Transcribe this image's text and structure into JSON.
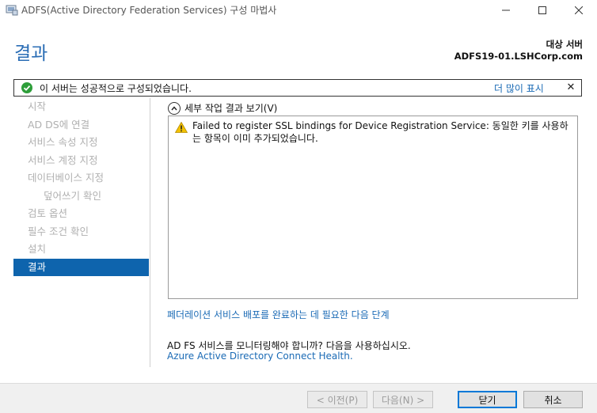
{
  "window": {
    "title": "ADFS(Active Directory Federation Services) 구성 마법사",
    "icons": {
      "app": "server-config-icon",
      "minimize": "minimize-icon",
      "maximize": "maximize-icon",
      "close": "close-icon"
    }
  },
  "header": {
    "title": "결과",
    "target_label": "대상 서버",
    "target_value": "ADFS19-01.LSHCorp.com"
  },
  "status": {
    "text": "이 서버는 성공적으로 구성되었습니다.",
    "show_more": "더 많이 표시",
    "close_glyph": "✕",
    "icon": "check-circle-icon",
    "color": "#2e9e3a"
  },
  "sidebar": {
    "items": [
      {
        "label": "시작",
        "active": false,
        "sub": false
      },
      {
        "label": "AD DS에 연결",
        "active": false,
        "sub": false
      },
      {
        "label": "서비스 속성 지정",
        "active": false,
        "sub": false
      },
      {
        "label": "서비스 계정 지정",
        "active": false,
        "sub": false
      },
      {
        "label": "데이터베이스 지정",
        "active": false,
        "sub": false
      },
      {
        "label": "덮어쓰기 확인",
        "active": false,
        "sub": true
      },
      {
        "label": "검토 옵션",
        "active": false,
        "sub": false
      },
      {
        "label": "필수 조건 확인",
        "active": false,
        "sub": false
      },
      {
        "label": "설치",
        "active": false,
        "sub": false
      },
      {
        "label": "결과",
        "active": true,
        "sub": false
      }
    ],
    "accent": "#0e64ad"
  },
  "main": {
    "details_toggle": "세부 작업 결과 보기(V)",
    "warning": {
      "icon": "warning-icon",
      "text": "Failed to register SSL bindings for Device Registration Service: 동일한 키를 사용하는 항목이 이미 추가되었습니다."
    },
    "next_steps_link": "페더레이션 서비스 배포를 완료하는 데 필요한 다음 단계",
    "monitor_text": "AD FS 서비스를 모니터링해야 합니까? 다음을 사용하십시오.",
    "aad_link": "Azure Active Directory Connect Health."
  },
  "footer": {
    "prev": "< 이전(P)",
    "next": "다음(N) >",
    "close": "닫기",
    "cancel": "취소"
  }
}
